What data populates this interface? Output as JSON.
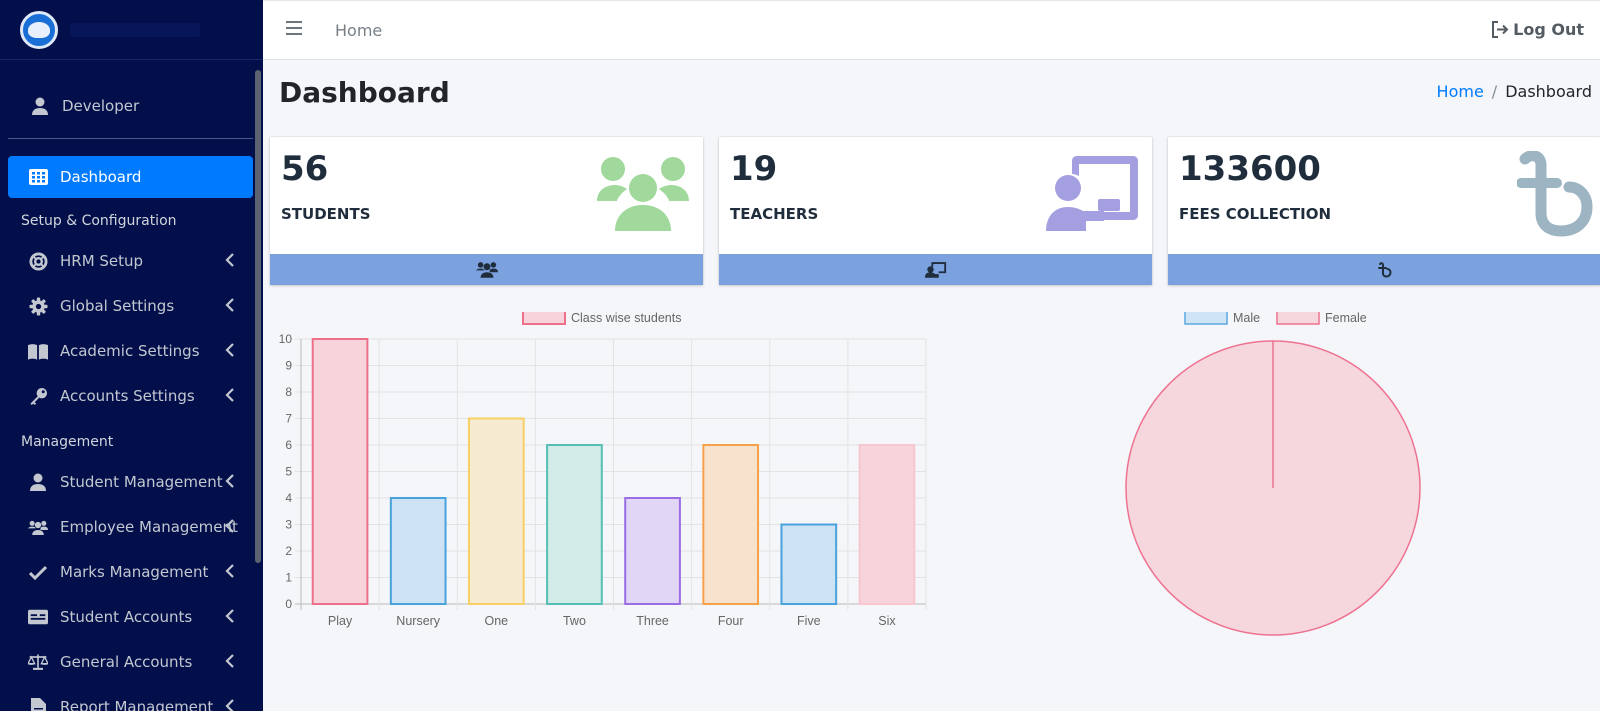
{
  "sidebar": {
    "user": {
      "name": "Developer"
    },
    "items": [
      {
        "label": "Dashboard",
        "active": true
      },
      {
        "label": "HRM Setup"
      },
      {
        "label": "Global Settings"
      },
      {
        "label": "Academic Settings"
      },
      {
        "label": "Accounts Settings"
      },
      {
        "label": "Student Management"
      },
      {
        "label": "Employee Management"
      },
      {
        "label": "Marks Management"
      },
      {
        "label": "Student Accounts"
      },
      {
        "label": "General Accounts"
      },
      {
        "label": "Report Management"
      }
    ],
    "headers": {
      "setup": "Setup & Configuration",
      "management": "Management"
    }
  },
  "topbar": {
    "home_link": "Home",
    "logout_label": "Log Out"
  },
  "page": {
    "title": "Dashboard"
  },
  "breadcrumb": {
    "home": "Home",
    "separator": "/",
    "current": "Dashboard"
  },
  "stats": [
    {
      "value": "56",
      "label": "STUDENTS",
      "icon": "users-icon",
      "color": "#a0d99b"
    },
    {
      "value": "19",
      "label": "TEACHERS",
      "icon": "chalkboard-teacher-icon",
      "color": "#a49fe0"
    },
    {
      "value": "133600",
      "label": "FEES COLLECTION",
      "icon": "taka-icon",
      "color": "#9db4c3"
    }
  ],
  "colors": {
    "sidebar_bg": "#030f4a",
    "active": "#007bff",
    "stat_footer": "#7ba1df"
  },
  "chart_data": [
    {
      "type": "bar",
      "legend": [
        "Class wise students"
      ],
      "categories": [
        "Play",
        "Nursery",
        "One",
        "Two",
        "Three",
        "Four",
        "Five",
        "Six"
      ],
      "series": [
        {
          "name": "Class wise students",
          "values": [
            10,
            4,
            7,
            6,
            4,
            6,
            3,
            6
          ]
        }
      ],
      "yticks": [
        "0",
        "1",
        "2",
        "3",
        "4",
        "5",
        "6",
        "7",
        "8",
        "9",
        "10"
      ],
      "ylim": [
        0,
        10
      ],
      "grid": true,
      "legend_position": "top",
      "bar_colors": [
        {
          "fill": "#f7d4dc",
          "stroke": "#ee6f8a"
        },
        {
          "fill": "#cde3f4",
          "stroke": "#4aa2dc"
        },
        {
          "fill": "#f6ebd1",
          "stroke": "#f7cf63"
        },
        {
          "fill": "#d2ece9",
          "stroke": "#56bfb4"
        },
        {
          "fill": "#e2d6f6",
          "stroke": "#9a6de4"
        },
        {
          "fill": "#f6e2cd",
          "stroke": "#f6a14a"
        },
        {
          "fill": "#cde3f4",
          "stroke": "#4aa2dc"
        },
        {
          "fill": "#f7d4dc",
          "stroke": "#f7c6d0"
        }
      ]
    },
    {
      "type": "pie",
      "legend": [
        "Male",
        "Female"
      ],
      "labels": [
        "Male",
        "Female"
      ],
      "values": [
        0,
        56
      ],
      "legend_position": "top",
      "colors": [
        {
          "fill": "#cfe4f5",
          "stroke": "#5aa9e0"
        },
        {
          "fill": "#f7d7de",
          "stroke": "#ee7290"
        }
      ]
    }
  ]
}
